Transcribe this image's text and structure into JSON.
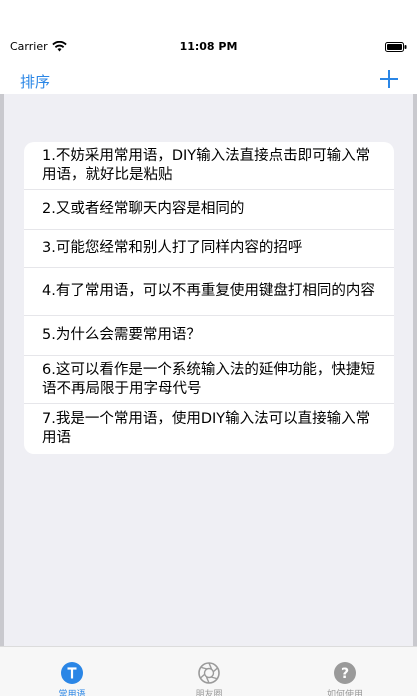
{
  "status": {
    "carrier": "Carrier",
    "time": "11:08 PM"
  },
  "nav": {
    "left_label": "排序",
    "add_icon": "plus-icon"
  },
  "phrases": [
    "1.不妨采用常用语，DIY输入法直接点击即可输入常用语，就好比是粘贴",
    "2.又或者经常聊天内容是相同的",
    "3.可能您经常和别人打了同样内容的招呼",
    "4.有了常用语，可以不再重复使用键盘打相同的内容",
    "5.为什么会需要常用语？",
    "6.这可以看作是一个系统输入法的延伸功能，快捷短语不再局限于用字母代号",
    "7.我是一个常用语，使用DIY输入法可以直接输入常用语"
  ],
  "tabs": [
    {
      "label": "常用语",
      "icon": "t-icon",
      "active": true
    },
    {
      "label": "朋友圈",
      "icon": "aperture-icon",
      "active": false
    },
    {
      "label": "如何使用",
      "icon": "help-icon",
      "active": false
    }
  ],
  "colors": {
    "accent": "#2a86e6",
    "background": "#efeff4",
    "inactive": "#9a9a9a"
  }
}
